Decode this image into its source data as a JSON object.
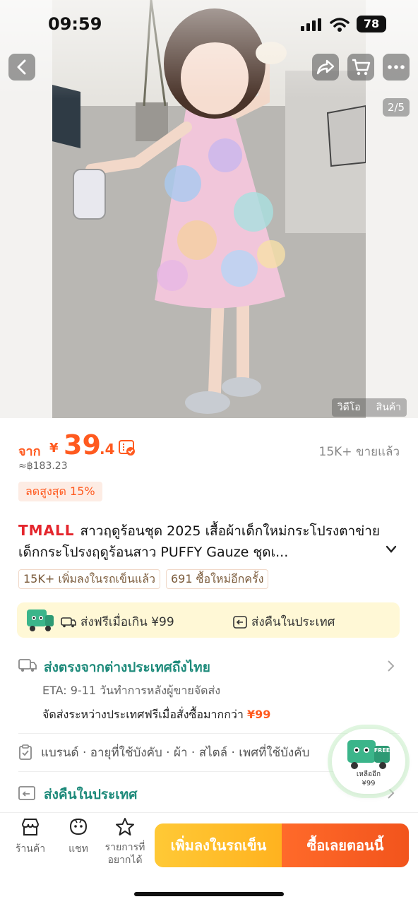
{
  "status_bar": {
    "time": "09:59",
    "battery": "78"
  },
  "media": {
    "counter": "2/5",
    "tab_video": "วิดีโอ",
    "tab_product": "สินค้า"
  },
  "price": {
    "from_label": "จาก",
    "currency": "¥",
    "integer": "39",
    "decimal": ".4",
    "approx": "≈฿183.23",
    "sold": "15K+ ขายแล้ว",
    "discount": "ลดสูงสุด 15%"
  },
  "product": {
    "brand": "TMALL",
    "title": "สาวฤดูร้อนชุด 2025 เสื้อผ้าเด็กใหม่กระโปรงตาข่ายเด็กกระโปรงฤดูร้อนสาว PUFFY Gauze ชุดเ..."
  },
  "tags": [
    "15K+ เพิ่มลงในรถเข็นแล้ว",
    "691 ซื้อใหม่อีกครั้ง"
  ],
  "shipping_banner": {
    "free_ship": "ส่งฟรีเมื่อเกิน ¥99",
    "domestic_return": "ส่งคืนในประเทศ"
  },
  "shipping": {
    "title": "ส่งตรงจากต่างประเทศถึงไทย",
    "eta": "ETA: 9-11 วันทำการหลังผู้ขายจัดส่ง",
    "free_intl": "จัดส่งระหว่างประเทศฟรีเมื่อสั่งซื้อมากกว่า",
    "free_intl_amount": "¥99"
  },
  "attributes": "แบรนด์ · อายุที่ใช้บังคับ · ผ้า · สไตล์ · เพศที่ใช้บังคับ",
  "returns": {
    "title": "ส่งคืนในประเทศ"
  },
  "float_badge": {
    "line1": "เหลืออีก",
    "line2": "¥99",
    "free": "FREE"
  },
  "bottom_bar": {
    "store": "ร้านค้า",
    "chat": "แชท",
    "wishlist_line1": "รายการที่",
    "wishlist_line2": "อยากได้",
    "add_to_cart": "เพิ่มลงในรถเข็น",
    "buy_now": "ซื้อเลยตอนนี้"
  },
  "colors": {
    "accent": "#ff5a1f",
    "teal": "#1d8a7a",
    "tmall": "#e4262d",
    "cart": "#ffb21f"
  }
}
